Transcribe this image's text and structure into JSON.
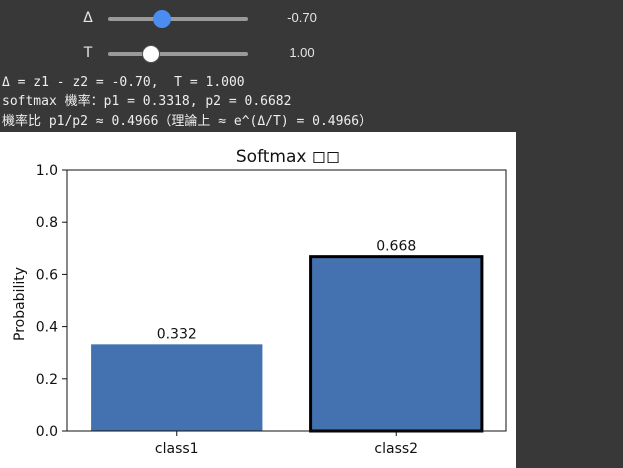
{
  "controls": {
    "delta": {
      "label": "Δ",
      "value_text": "-0.70",
      "min": -3,
      "max": 3,
      "value": -0.7,
      "color": "#4a8cf0"
    },
    "temperature": {
      "label": "T",
      "value_text": "1.00",
      "min": 0.1,
      "max": 3,
      "value": 1.0
    }
  },
  "output": {
    "line1": "Δ = z1 - z2 = -0.70,  T = 1.000",
    "line2": "softmax 機率：p1 = 0.3318, p2 = 0.6682",
    "line3": "機率比 p1/p2 ≈ 0.4966（理論上 ≈ e^(Δ/T) = 0.4966）"
  },
  "chart_data": {
    "type": "bar",
    "title": "Softmax ◻◻",
    "ylabel": "Probability",
    "xlabel": "",
    "categories": [
      "class1",
      "class2"
    ],
    "values": [
      0.332,
      0.668
    ],
    "value_labels": [
      "0.332",
      "0.668"
    ],
    "highlight_index": 1,
    "ylim": [
      0,
      1.0
    ],
    "yticks": [
      "0.0",
      "0.2",
      "0.4",
      "0.6",
      "0.8",
      "1.0"
    ],
    "bar_color": "#4472b0",
    "grid": false
  }
}
